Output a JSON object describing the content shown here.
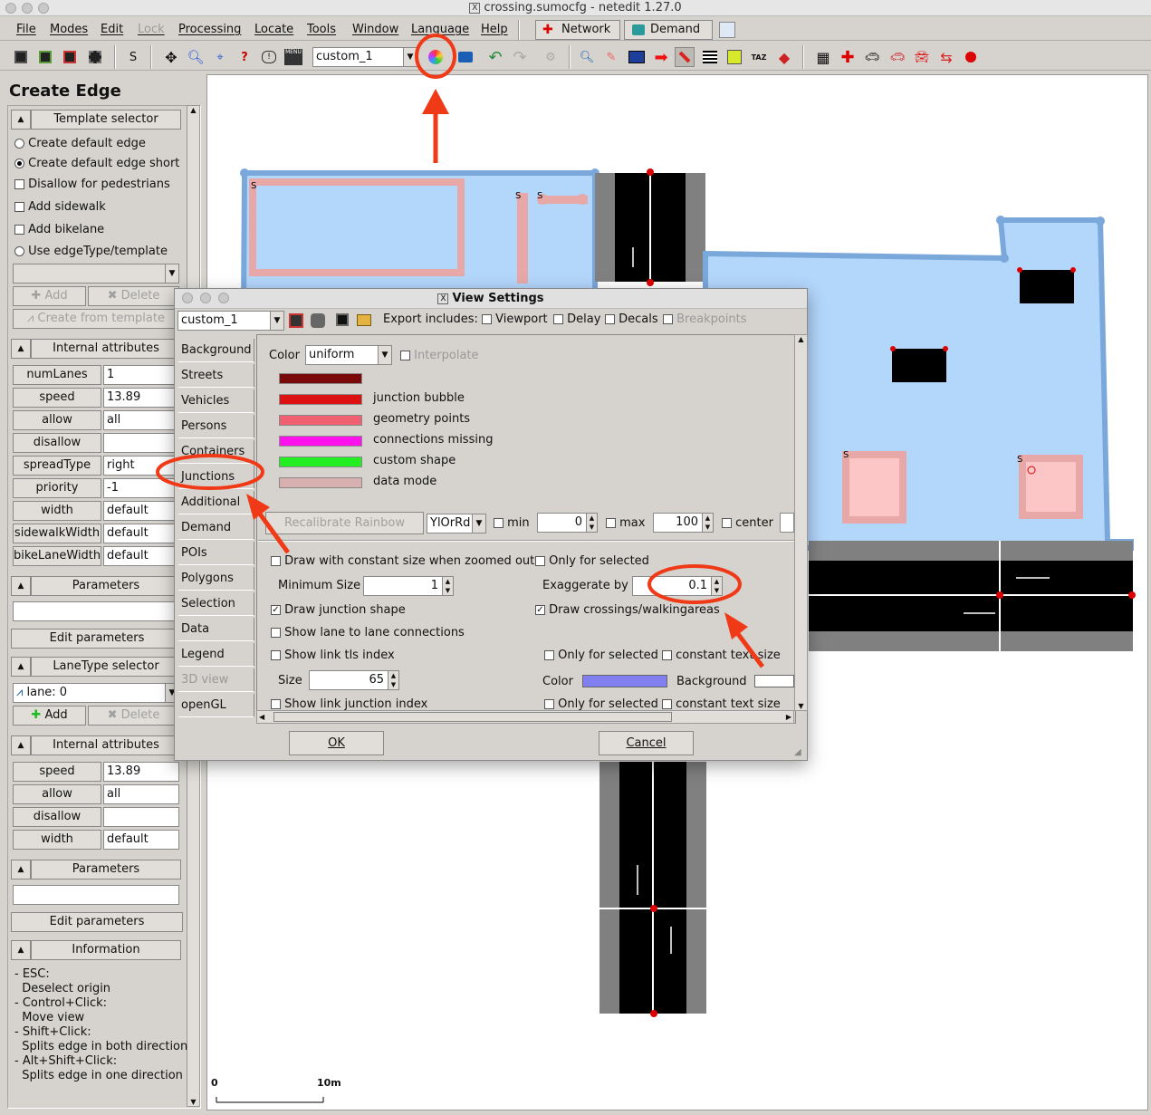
{
  "window": {
    "title": "crossing.sumocfg - netedit 1.27.0"
  },
  "menu": [
    "File",
    "Modes",
    "Edit",
    "Lock",
    "Processing",
    "Locate",
    "Tools",
    "Window",
    "Language",
    "Help"
  ],
  "modes": {
    "network": "Network",
    "demand": "Demand"
  },
  "toolbar": {
    "s_label": "S",
    "scheme": "custom_1"
  },
  "left": {
    "title": "Create Edge",
    "template_selector": "Template selector",
    "options": {
      "default": "Create default edge",
      "default_short": "Create default edge short",
      "disallow_ped": "Disallow for pedestrians",
      "sidewalk": "Add sidewalk",
      "bikelane": "Add bikelane",
      "use_type": "Use edgeType/template"
    },
    "add": "Add",
    "delete": "Delete",
    "create_from_template": "Create from template",
    "internal_attributes": "Internal attributes",
    "attrs": [
      {
        "name": "numLanes",
        "value": "1"
      },
      {
        "name": "speed",
        "value": "13.89"
      },
      {
        "name": "allow",
        "value": "all"
      },
      {
        "name": "disallow",
        "value": ""
      },
      {
        "name": "spreadType",
        "value": "right"
      },
      {
        "name": "priority",
        "value": "-1"
      },
      {
        "name": "width",
        "value": "default"
      },
      {
        "name": "sidewalkWidth",
        "value": "default"
      },
      {
        "name": "bikeLaneWidth",
        "value": "default"
      }
    ],
    "parameters": "Parameters",
    "edit_parameters": "Edit parameters",
    "lanetype_selector": "LaneType selector",
    "lane": "lane: 0",
    "lane_attrs": [
      {
        "name": "speed",
        "value": "13.89"
      },
      {
        "name": "allow",
        "value": "all"
      },
      {
        "name": "disallow",
        "value": ""
      },
      {
        "name": "width",
        "value": "default"
      }
    ],
    "information": "Information",
    "info_lines": [
      "- ESC:",
      "  Deselect origin",
      "- Control+Click:",
      "  Move view",
      "- Shift+Click:",
      "  Splits edge in both direction",
      "- Alt+Shift+Click:",
      "  Splits edge in one direction"
    ]
  },
  "scale": {
    "zero": "0",
    "ten": "10m"
  },
  "dialog": {
    "title": "View Settings",
    "scheme": "custom_1",
    "export_includes": "Export includes:",
    "export": {
      "viewport": "Viewport",
      "delay": "Delay",
      "decals": "Decals",
      "breakpoints": "Breakpoints"
    },
    "tabs": [
      "Background",
      "Streets",
      "Vehicles",
      "Persons",
      "Containers",
      "Junctions",
      "Additional",
      "Demand",
      "POIs",
      "Polygons",
      "Selection",
      "Data",
      "Legend",
      "3D view",
      "openGL"
    ],
    "active_tab": "Junctions",
    "color_label": "Color",
    "color_mode": "uniform",
    "interpolate": "Interpolate",
    "swatches": [
      {
        "color": "#7a0a0a",
        "label": ""
      },
      {
        "color": "#dd1111",
        "label": "junction bubble"
      },
      {
        "color": "#f06070",
        "label": "geometry points"
      },
      {
        "color": "#ff11ee",
        "label": "connections missing"
      },
      {
        "color": "#22ee22",
        "label": "custom shape"
      },
      {
        "color": "#d8b0b0",
        "label": "data mode"
      }
    ],
    "recalibrate": "Recalibrate Rainbow",
    "palette": "YlOrRd",
    "min_label": "min",
    "min_value": "0",
    "max_label": "max",
    "max_value": "100",
    "center_label": "center",
    "draw_const": "Draw with constant size when zoomed out",
    "only_selected": "Only for selected",
    "min_size_label": "Minimum Size",
    "min_size": "1",
    "exaggerate_label": "Exaggerate by",
    "exaggerate": "0.1",
    "draw_junction_shape": "Draw junction shape",
    "draw_crossings": "Draw crossings/walkingareas",
    "show_l2l": "Show lane to lane connections",
    "show_tls": "Show link tls index",
    "constant_text": "constant text size",
    "size_label": "Size",
    "size": "65",
    "color2": "Color",
    "background": "Background",
    "show_junction_index": "Show link junction index",
    "ok": "OK",
    "cancel": "Cancel"
  },
  "colors": {
    "annotation": "#f03a17",
    "junction_fill": "#b3d6fb",
    "junction_border": "#7aa8db"
  }
}
